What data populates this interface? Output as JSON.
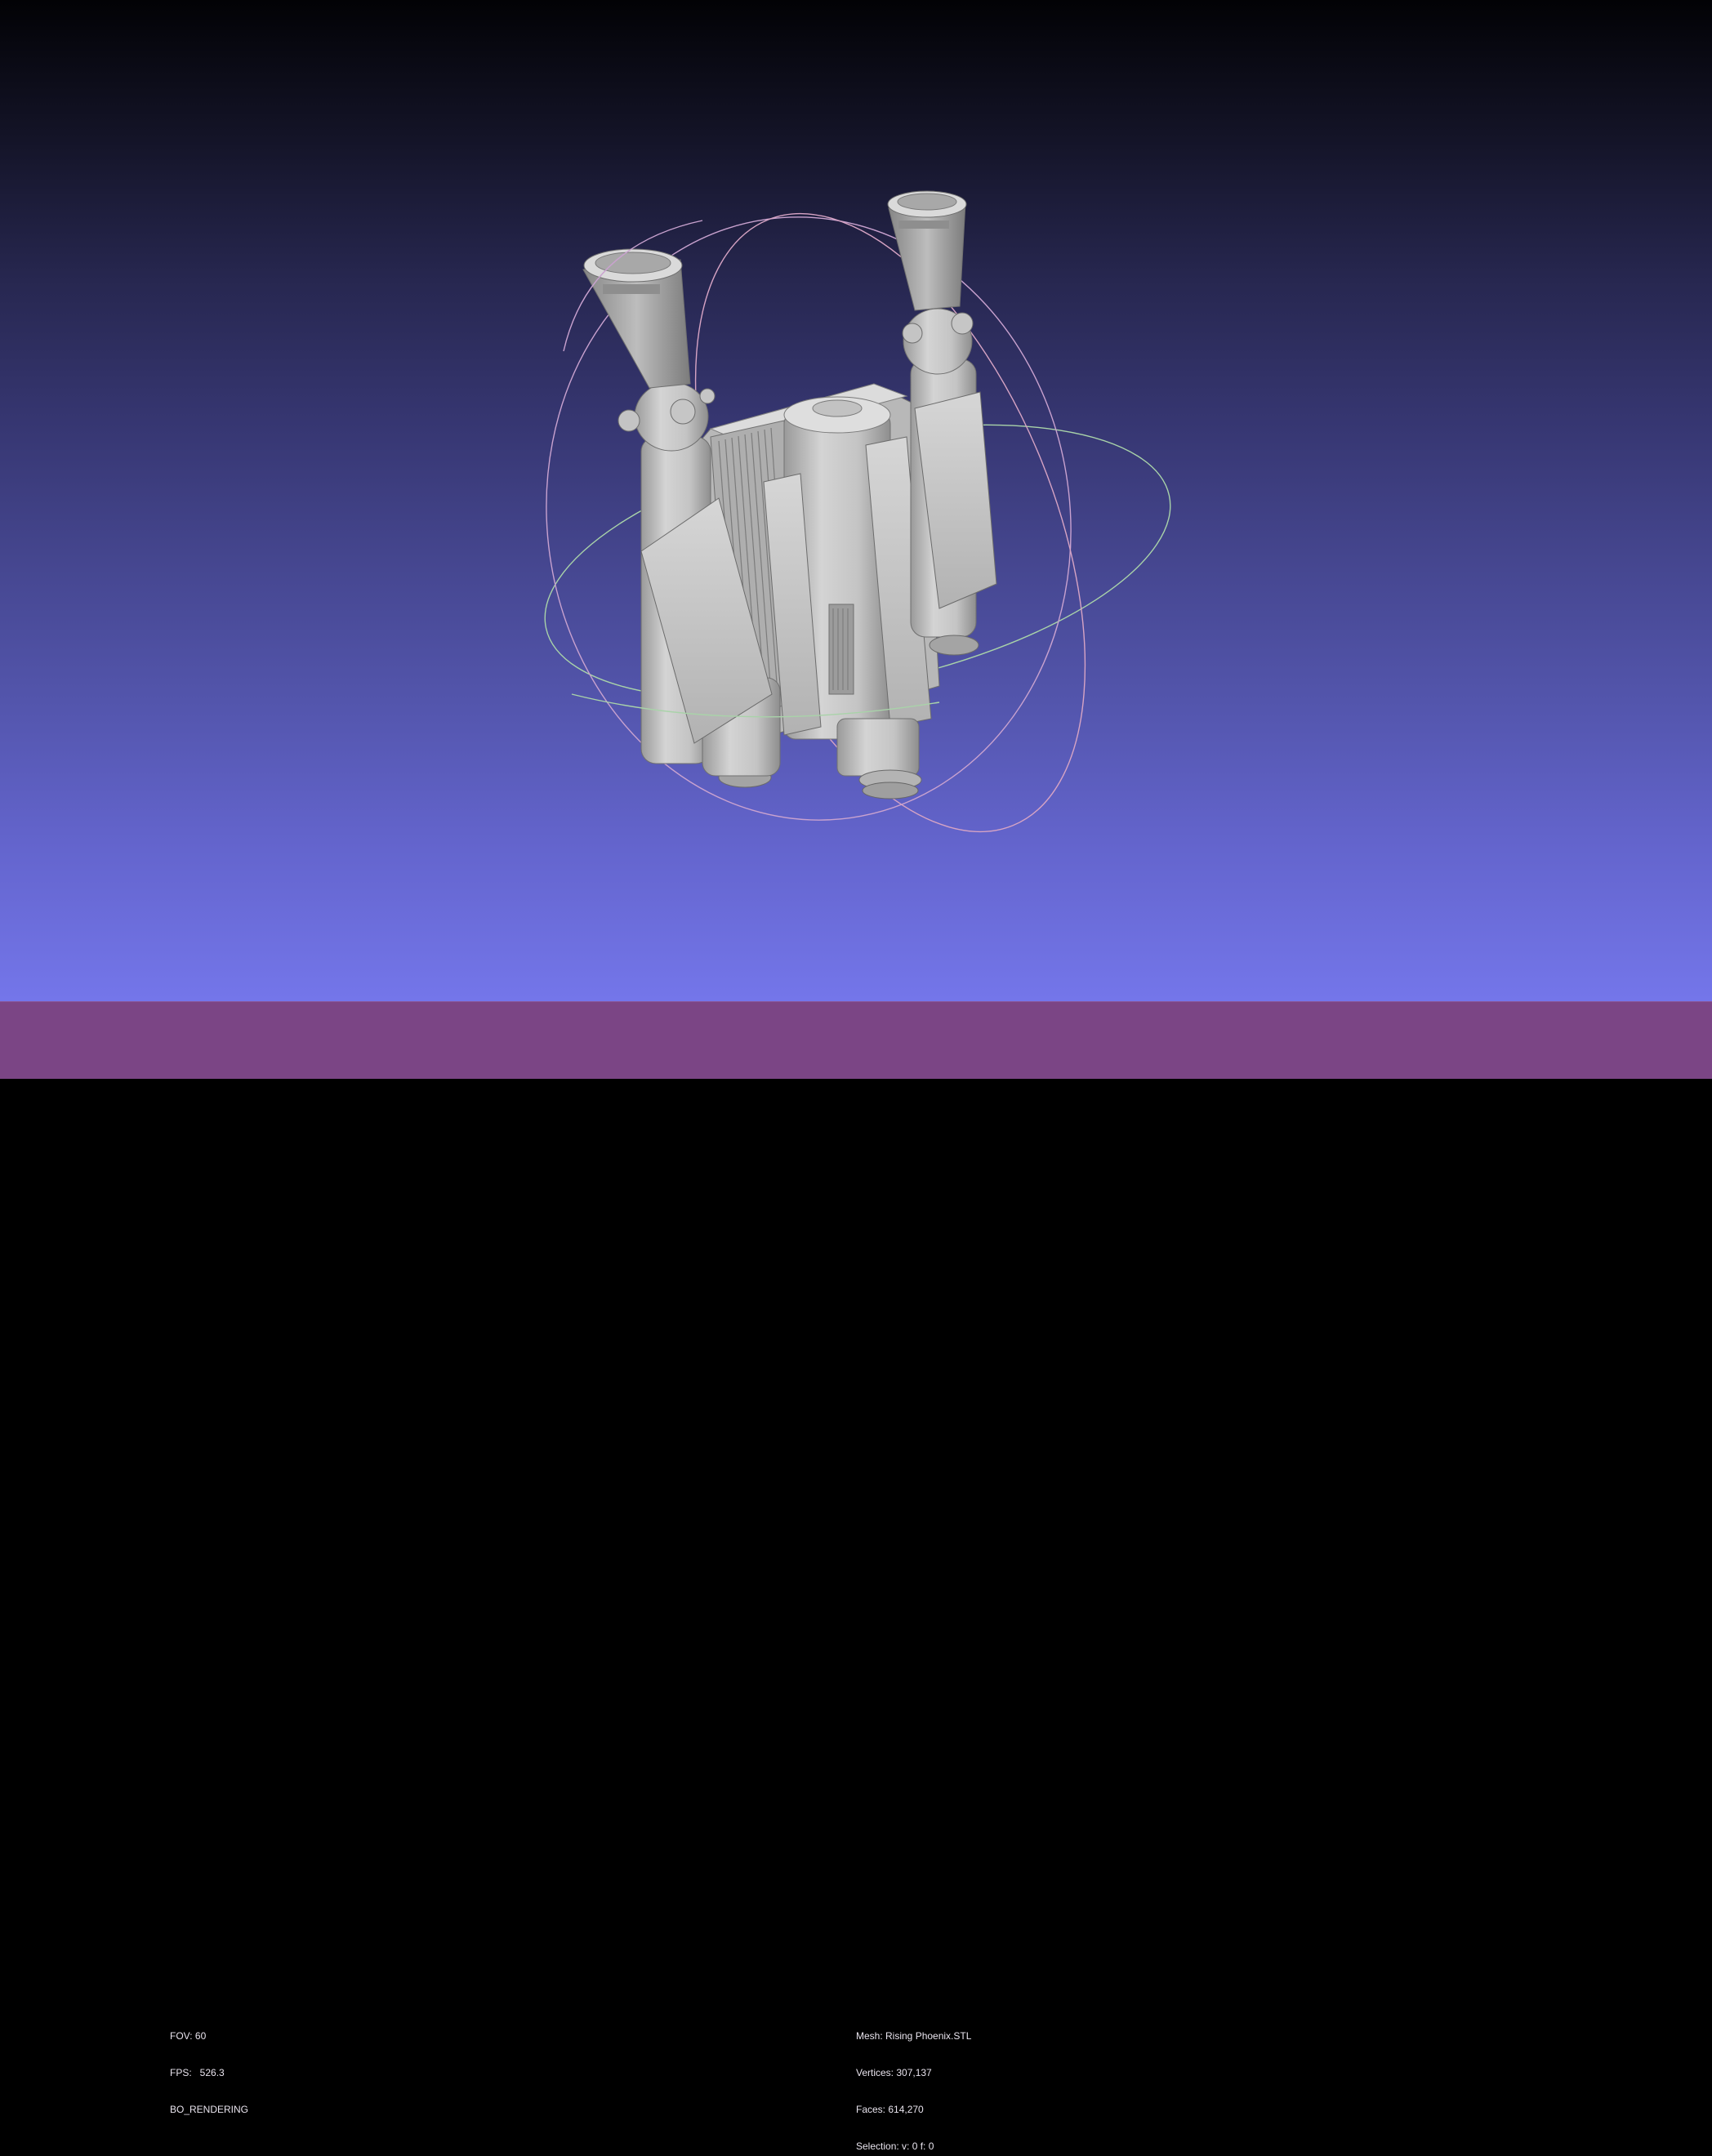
{
  "app": {
    "view": "3D mesh viewport",
    "background_colors": {
      "top": "#020205",
      "bottom": "#7476ea",
      "status_bar": "#7b4585"
    }
  },
  "render_info": {
    "fov": "FOV: 60",
    "fps": "FPS:   526.3",
    "mode": "BO_RENDERING"
  },
  "mesh_info": {
    "mesh": "Mesh: Rising Phoenix.STL",
    "vertices": "Vertices: 307,137",
    "faces": "Faces: 614,270",
    "selection": "Selection: v: 0 f: 0"
  },
  "trackball": {
    "colors": {
      "x": "#c9a2cf",
      "y": "#a9d3a9",
      "z": "#d7a4c4"
    }
  },
  "model": {
    "name": "jetpack-mesh",
    "color": "#c8c8c8"
  }
}
